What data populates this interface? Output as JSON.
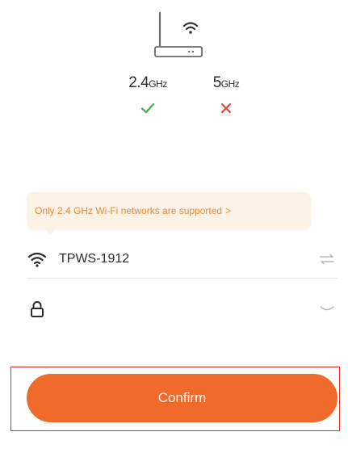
{
  "bands": {
    "band_24": {
      "value": "2.4",
      "unit": "GHz",
      "status_icon": "check-icon",
      "status": "supported"
    },
    "band_5": {
      "value": "5",
      "unit": "GHz",
      "status_icon": "cross-icon",
      "status": "not-supported"
    }
  },
  "notice": {
    "text": "Only 2.4 GHz Wi-Fi networks are supported",
    "arrow": ">"
  },
  "wifi": {
    "ssid": "TPWS-1912",
    "leading_icon": "wifi-icon",
    "trailing_icon": "switch-network-icon"
  },
  "password": {
    "value": "",
    "leading_icon": "lock-icon",
    "trailing_icon": "eye-closed-icon"
  },
  "confirm": {
    "label": "Confirm"
  },
  "colors": {
    "accent": "#f06a2c",
    "notice_text": "#e8873a",
    "notice_bg": "#fcf3e6",
    "ok": "#41b24a",
    "error": "#e2453a",
    "highlight_border": "#e0302b"
  }
}
